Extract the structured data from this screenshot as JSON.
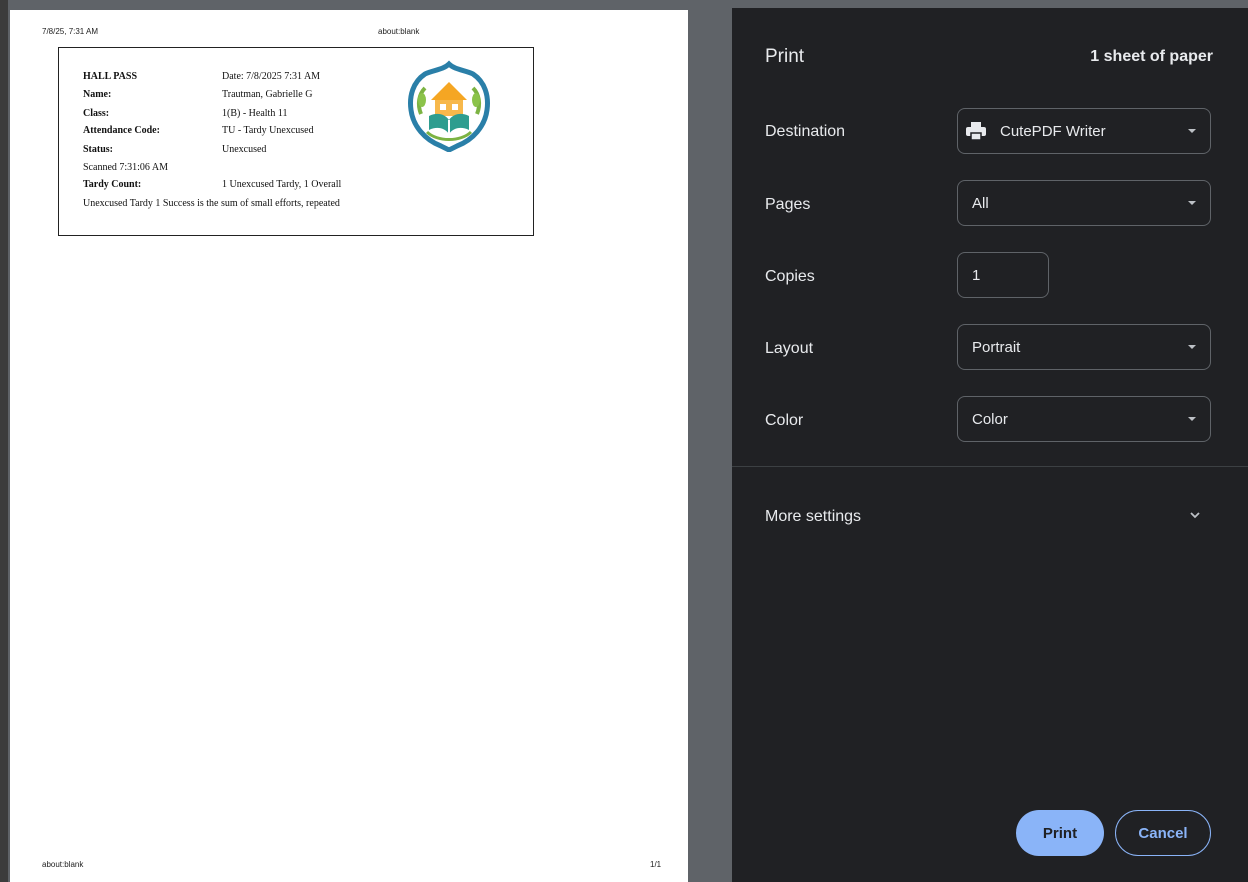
{
  "preview": {
    "header_left": "7/8/25, 7:31 AM",
    "header_center": "about:blank",
    "footer_left": "about:blank",
    "footer_right": "1/1",
    "hall_pass": {
      "title": "HALL PASS",
      "date": "Date: 7/8/2025 7:31 AM",
      "name_label": "Name:",
      "name_value": "Trautman, Gabrielle G",
      "class_label": "Class:",
      "class_value": "1(B) - Health 11",
      "attendance_label": "Attendance Code:",
      "attendance_value": "TU - Tardy Unexcused",
      "status_label": "Status:",
      "status_value": "Unexcused",
      "scanned": "Scanned 7:31:06 AM",
      "tardy_label": "Tardy Count:",
      "tardy_value": "1 Unexcused Tardy, 1 Overall",
      "footer_text": "Unexcused Tardy 1 Success is the sum of small efforts, repeated",
      "logo_icon": "school-crest-icon"
    }
  },
  "panel": {
    "title": "Print",
    "sheet_count": "1 sheet of paper",
    "destination_label": "Destination",
    "destination_value": "CutePDF Writer",
    "pages_label": "Pages",
    "pages_value": "All",
    "copies_label": "Copies",
    "copies_value": "1",
    "layout_label": "Layout",
    "layout_value": "Portrait",
    "color_label": "Color",
    "color_value": "Color",
    "more_settings_label": "More settings",
    "print_button": "Print",
    "cancel_button": "Cancel"
  },
  "colors": {
    "panel_bg": "#202124",
    "accent": "#8ab4f8",
    "preview_bg": "#5f6368"
  }
}
